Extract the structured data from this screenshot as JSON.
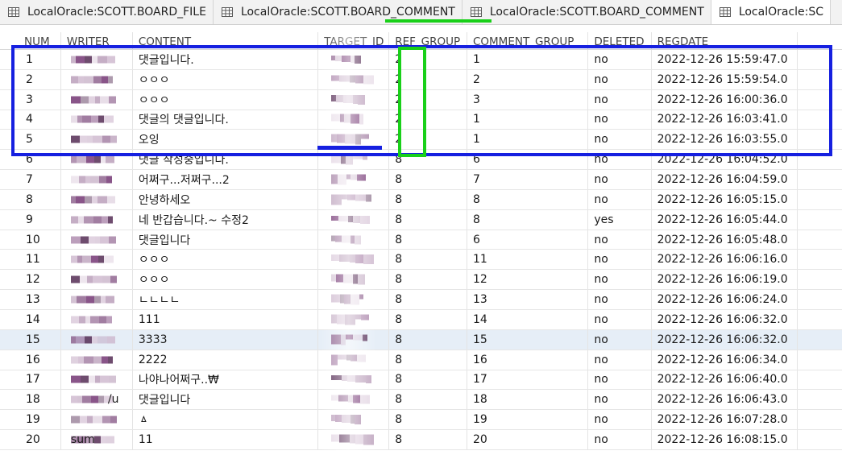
{
  "tabs": [
    {
      "label": "LocalOracle:SCOTT.BOARD_FILE",
      "active": false
    },
    {
      "label": "LocalOracle:SCOTT.BOARD_COMMENT",
      "active": false
    },
    {
      "label": "LocalOracle:SCOTT.BOARD_COMMENT",
      "active": false
    },
    {
      "label": "LocalOracle:SC",
      "active": true
    }
  ],
  "columns": [
    "NUM",
    "WRITER",
    "CONTENT",
    "TARGET_ID",
    "REF_GROUP",
    "COMMENT_GROUP",
    "DELETED",
    "REGDATE"
  ],
  "rows": [
    {
      "num": "1",
      "content": "댓글입니다.",
      "ref_group": "2",
      "comment_group": "1",
      "deleted": "no",
      "regdate": "2022-12-26 15:59:47.0"
    },
    {
      "num": "2",
      "content": "ㅇㅇㅇ",
      "ref_group": "2",
      "comment_group": "2",
      "deleted": "no",
      "regdate": "2022-12-26 15:59:54.0"
    },
    {
      "num": "3",
      "content": "ㅇㅇㅇ",
      "ref_group": "2",
      "comment_group": "3",
      "deleted": "no",
      "regdate": "2022-12-26 16:00:36.0"
    },
    {
      "num": "4",
      "content": "댓글의 댓글입니다.",
      "ref_group": "2",
      "comment_group": "1",
      "deleted": "no",
      "regdate": "2022-12-26 16:03:41.0"
    },
    {
      "num": "5",
      "content": "오잉",
      "ref_group": "2",
      "comment_group": "1",
      "deleted": "no",
      "regdate": "2022-12-26 16:03:55.0"
    },
    {
      "num": "6",
      "content": "댓글 작성중입니다.",
      "ref_group": "8",
      "comment_group": "6",
      "deleted": "no",
      "regdate": "2022-12-26 16:04:52.0"
    },
    {
      "num": "7",
      "content": "어쩌구...저쩌구...2",
      "ref_group": "8",
      "comment_group": "7",
      "deleted": "no",
      "regdate": "2022-12-26 16:04:59.0"
    },
    {
      "num": "8",
      "content": "안녕하세오",
      "ref_group": "8",
      "comment_group": "8",
      "deleted": "no",
      "regdate": "2022-12-26 16:05:15.0"
    },
    {
      "num": "9",
      "content": "네 반갑습니다.~ 수정2",
      "ref_group": "8",
      "comment_group": "8",
      "deleted": "yes",
      "regdate": "2022-12-26 16:05:44.0"
    },
    {
      "num": "10",
      "content": "댓글입니다",
      "ref_group": "8",
      "comment_group": "6",
      "deleted": "no",
      "regdate": "2022-12-26 16:05:48.0"
    },
    {
      "num": "11",
      "content": "ㅇㅇㅇ",
      "ref_group": "8",
      "comment_group": "11",
      "deleted": "no",
      "regdate": "2022-12-26 16:06:16.0"
    },
    {
      "num": "12",
      "content": "ㅇㅇㅇ",
      "ref_group": "8",
      "comment_group": "12",
      "deleted": "no",
      "regdate": "2022-12-26 16:06:19.0"
    },
    {
      "num": "13",
      "content": "ㄴㄴㄴㄴ",
      "ref_group": "8",
      "comment_group": "13",
      "deleted": "no",
      "regdate": "2022-12-26 16:06:24.0"
    },
    {
      "num": "14",
      "content": "111",
      "ref_group": "8",
      "comment_group": "14",
      "deleted": "no",
      "regdate": "2022-12-26 16:06:32.0"
    },
    {
      "num": "15",
      "content": "3333",
      "ref_group": "8",
      "comment_group": "15",
      "deleted": "no",
      "regdate": "2022-12-26 16:06:32.0"
    },
    {
      "num": "16",
      "content": "2222",
      "ref_group": "8",
      "comment_group": "16",
      "deleted": "no",
      "regdate": "2022-12-26 16:06:34.0"
    },
    {
      "num": "17",
      "content": "나야나어쩌구..₩",
      "ref_group": "8",
      "comment_group": "17",
      "deleted": "no",
      "regdate": "2022-12-26 16:06:40.0"
    },
    {
      "num": "18",
      "content": "댓글입니다",
      "ref_group": "8",
      "comment_group": "18",
      "deleted": "no",
      "regdate": "2022-12-26 16:06:43.0"
    },
    {
      "num": "19",
      "content": "ㅿ",
      "ref_group": "8",
      "comment_group": "19",
      "deleted": "no",
      "regdate": "2022-12-26 16:07:28.0"
    },
    {
      "num": "20",
      "content": "11",
      "ref_group": "8",
      "comment_group": "20",
      "deleted": "no",
      "regdate": "2022-12-26 16:08:15.0"
    }
  ],
  "partial_writer_text": {
    "row18": "/u",
    "row20": "sum"
  },
  "selected_row_num": "15",
  "colors": {
    "highlight_blue": "#1620e0",
    "highlight_green": "#19d019",
    "selected_row": "#e6eef7",
    "redaction": "#6b2a6b"
  },
  "icons": {
    "tab": "table-grid-icon"
  }
}
